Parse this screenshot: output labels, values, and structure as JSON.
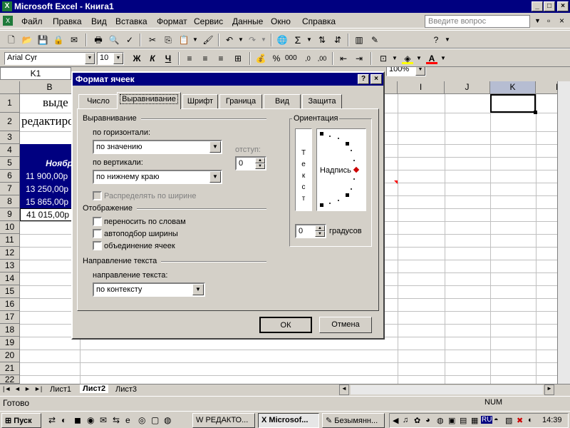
{
  "window": {
    "title": "Microsoft Excel - Книга1"
  },
  "menu": [
    "Файл",
    "Правка",
    "Вид",
    "Вставка",
    "Формат",
    "Сервис",
    "Данные",
    "Окно",
    "Справка"
  ],
  "ask_placeholder": "Введите вопрос",
  "toolbar": {
    "zoom": "100%",
    "font": "Arial Cyr",
    "size": "10",
    "bold": "Ж",
    "italic": "К",
    "underline": "Ч"
  },
  "namebox": "K1",
  "columns": [
    "B",
    "I",
    "J",
    "K",
    "L"
  ],
  "rows": [
    "1",
    "2",
    "3",
    "4",
    "5",
    "6",
    "7",
    "8",
    "9",
    "10",
    "11",
    "12",
    "13",
    "14",
    "15",
    "16",
    "17",
    "18",
    "19",
    "20",
    "21",
    "22"
  ],
  "cells": {
    "b1": "выде",
    "b2": "редактиро",
    "b5": "Ноябр",
    "b6": "11 900,00р",
    "b7": "13 250,00р",
    "b8": "15 865,00р",
    "b9": "41 015,00р"
  },
  "sheets": [
    "Лист1",
    "Лист2",
    "Лист3"
  ],
  "status": {
    "ready": "Готово",
    "num": "NUM"
  },
  "taskbar": {
    "start": "Пуск",
    "items": [
      "РЕДАКТО...",
      "Microsof...",
      "Безымянн..."
    ],
    "clock": "14:39"
  },
  "dialog": {
    "title": "Формат ячеек",
    "tabs": [
      "Число",
      "Выравнивание",
      "Шрифт",
      "Граница",
      "Вид",
      "Защита"
    ],
    "align_group": "Выравнивание",
    "horiz_label": "по горизонтали:",
    "horiz_value": "по значению",
    "indent_label": "отступ:",
    "indent_value": "0",
    "vert_label": "по вертикали:",
    "vert_value": "по нижнему краю",
    "distribute": "Распределять по ширине",
    "display_group": "Отображение",
    "wrap": "переносить по словам",
    "autofit": "автоподбор ширины",
    "merge": "объединение ячеек",
    "direction_group": "Направление текста",
    "direction_label": "направление текста:",
    "direction_value": "по контексту",
    "orientation_group": "Ориентация",
    "vertical_text": "Т е к с т",
    "label_text": "Надпись",
    "degrees_value": "0",
    "degrees_label": "градусов",
    "ok": "ОК",
    "cancel": "Отмена"
  }
}
